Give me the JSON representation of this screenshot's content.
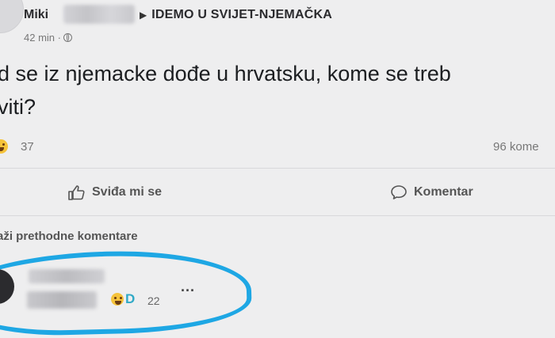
{
  "post": {
    "author": "Miki",
    "group": "IDEMO U SVIJET-NJEMAČKA",
    "time": "42 min ·",
    "text_line1": "d se iz njemacke dođe u hrvatsku, kome se treb",
    "text_line2": "viti?",
    "reaction_count": "37",
    "comment_count": "96 kome"
  },
  "actions": {
    "like_label": "Sviđa mi se",
    "comment_label": "Komentar"
  },
  "comments": {
    "show_previous": "aži prethodne komentare",
    "first": {
      "reaction_count": "22",
      "more": "..."
    }
  },
  "icons": [
    "globe-icon",
    "like-thumb-icon",
    "comment-bubble-icon",
    "haha-emoji-icon",
    "more-icon"
  ],
  "colors": {
    "highlight_circle": "#1ea7e4",
    "background": "#eeeeef"
  }
}
